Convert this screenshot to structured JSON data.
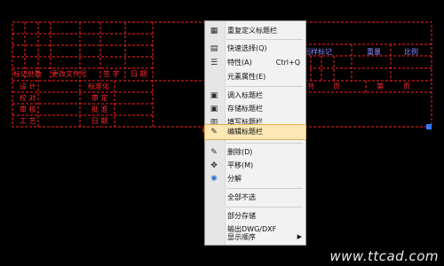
{
  "drawing": {
    "left_block": {
      "header_row": [
        "标记",
        "处数",
        "更改文件号",
        "签 字",
        "日 期"
      ],
      "rows": [
        [
          "设 计",
          "标准化"
        ],
        [
          "校 对",
          "审 定"
        ],
        [
          "审 核",
          "批 准"
        ],
        [
          "工 艺",
          "日 期"
        ]
      ]
    },
    "right_block": {
      "header_row": [
        "图样标记",
        "重量",
        "比例"
      ],
      "bottom_row": [
        "共",
        "页",
        "第",
        "页"
      ]
    },
    "colors": {
      "frame": "#ff1f1f",
      "text": "#ff2a2a",
      "label_blue": "#8a8aff",
      "grip": "#2f7bff"
    }
  },
  "context_menu": {
    "items": [
      {
        "label": "重复定义标题栏",
        "shortcut": "",
        "icon": "redefine-icon"
      },
      {
        "label": "快速选择(Q)",
        "shortcut": "",
        "icon": "quick-select-icon"
      },
      {
        "label": "特性(A)",
        "shortcut": "Ctrl+Q",
        "icon": "properties-icon"
      },
      {
        "label": "元素属性(E)",
        "shortcut": "",
        "icon": ""
      },
      {
        "label": "调入标题栏",
        "shortcut": "",
        "icon": "load-titleblock-icon"
      },
      {
        "label": "存储标题栏",
        "shortcut": "",
        "icon": "save-titleblock-icon"
      },
      {
        "label": "填写标题栏",
        "shortcut": "",
        "icon": "fill-titleblock-icon"
      },
      {
        "label": "编辑标题栏",
        "shortcut": "",
        "icon": "edit-titleblock-icon",
        "highlighted": true
      },
      {
        "label": "删除(D)",
        "shortcut": "",
        "icon": "delete-icon"
      },
      {
        "label": "平移(M)",
        "shortcut": "",
        "icon": "move-icon"
      },
      {
        "label": "分解",
        "shortcut": "",
        "icon": "explode-icon"
      },
      {
        "label": "全部不选",
        "shortcut": "",
        "icon": ""
      },
      {
        "label": "部分存储",
        "shortcut": "",
        "icon": ""
      },
      {
        "label": "输出DWG/DXF",
        "shortcut": "",
        "icon": ""
      },
      {
        "label": "显示顺序",
        "shortcut": "",
        "icon": "",
        "submenu": true
      }
    ]
  },
  "watermark": "www.ttcad.com"
}
